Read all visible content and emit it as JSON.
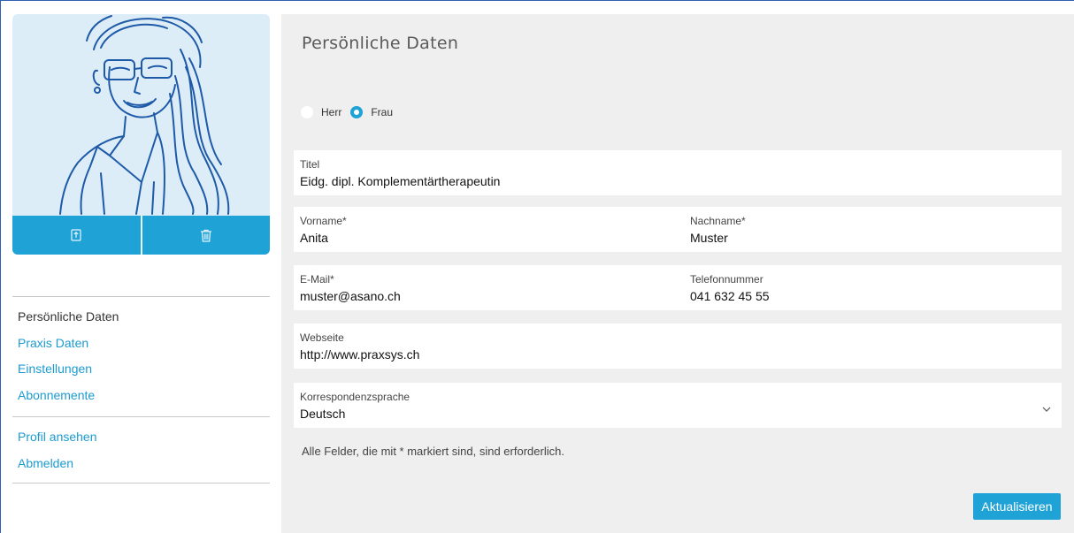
{
  "colors": {
    "accent": "#1fa2d6",
    "link": "#1c9bd0",
    "panel_bg": "#efefef",
    "avatar_bg": "#dcedf7"
  },
  "avatar": {
    "upload_icon": "upload-icon",
    "delete_icon": "trash-icon"
  },
  "sidebar": {
    "nav_primary": [
      {
        "label": "Persönliche Daten",
        "active": true
      },
      {
        "label": "Praxis Daten",
        "active": false
      },
      {
        "label": "Einstellungen",
        "active": false
      },
      {
        "label": "Abonnemente",
        "active": false
      }
    ],
    "nav_secondary": [
      {
        "label": "Profil ansehen"
      },
      {
        "label": "Abmelden"
      }
    ]
  },
  "main": {
    "title": "Persönliche Daten",
    "salutation": {
      "options": [
        {
          "label": "Herr",
          "selected": false
        },
        {
          "label": "Frau",
          "selected": true
        }
      ]
    },
    "fields": {
      "titel": {
        "label": "Titel",
        "value": "Eidg. dipl. Komplementärtherapeutin"
      },
      "vorname": {
        "label": "Vorname*",
        "value": "Anita"
      },
      "nachname": {
        "label": "Nachname*",
        "value": "Muster"
      },
      "email": {
        "label": "E-Mail*",
        "value": "muster@asano.ch"
      },
      "telefon": {
        "label": "Telefonnummer",
        "value": "041 632 45 55"
      },
      "webseite": {
        "label": "Webseite",
        "value": "http://www.praxsys.ch"
      },
      "sprache": {
        "label": "Korrespondenzsprache",
        "value": "Deutsch"
      }
    },
    "required_note": "Alle Felder, die mit * markiert sind, sind erforderlich.",
    "update_button": "Aktualisieren"
  }
}
